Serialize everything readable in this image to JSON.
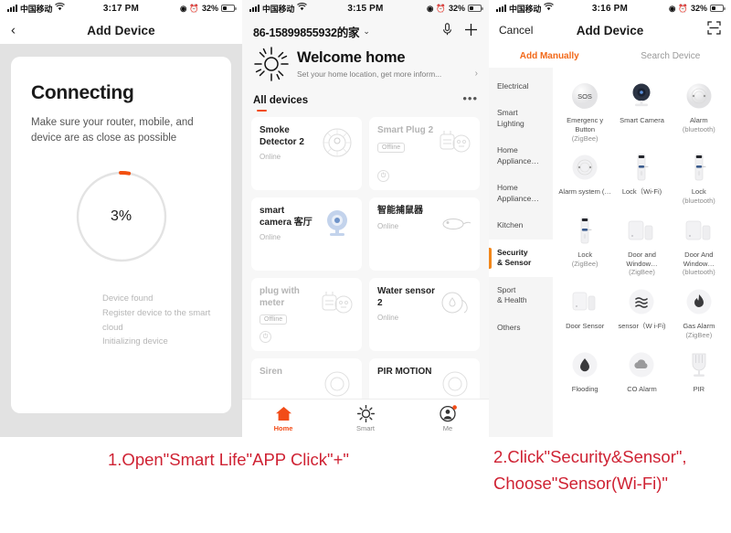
{
  "panel1": {
    "status": {
      "carrier": "中国移动",
      "wifi": "wifi-icon",
      "time": "3:17 PM",
      "battery_pct": "32%",
      "loc_icon": "location-icon",
      "alarm_icon": "alarm-icon"
    },
    "nav": {
      "back": "‹",
      "title": "Add Device"
    },
    "card": {
      "title": "Connecting",
      "subtitle": "Make sure your router, mobile, and device are as close as possible",
      "progress": "3%",
      "progress_value": 3,
      "steps": [
        "Device found",
        "Register device to the smart cloud",
        "Initializing device"
      ]
    }
  },
  "panel2": {
    "status": {
      "carrier": "中国移动",
      "time": "3:15 PM",
      "battery_pct": "32%"
    },
    "header": {
      "home_name": "86-15899855932的家",
      "caret": "⌄",
      "mic_icon": "microphone-icon",
      "add_icon": "plus-icon"
    },
    "welcome": {
      "sun_icon": "sun-icon",
      "title": "Welcome home",
      "subtitle": "Set your home location, get more inform...",
      "chevron": "›"
    },
    "section": {
      "label": "All devices",
      "more": "•••"
    },
    "devices": [
      {
        "name": "Smoke Detector 2",
        "status": "Online",
        "offline": false,
        "icon": "smoke-detector-icon",
        "power": false
      },
      {
        "name": "Smart Plug 2",
        "status": "Offline",
        "offline": true,
        "icon": "smart-plug-icon",
        "power": true
      },
      {
        "name": "smart camera 客厅",
        "status": "Online",
        "offline": false,
        "icon": "camera-icon",
        "power": false
      },
      {
        "name": "智能捕鼠器",
        "status": "Online",
        "offline": false,
        "icon": "mouse-trap-icon",
        "power": false
      },
      {
        "name": "plug with meter",
        "status": "Offline",
        "offline": true,
        "icon": "smart-plug-icon",
        "power": true
      },
      {
        "name": "Water sensor 2",
        "status": "Online",
        "offline": false,
        "icon": "water-sensor-icon",
        "power": false
      },
      {
        "name": "Siren",
        "status": "",
        "offline": false,
        "icon": "siren-icon",
        "power": false
      },
      {
        "name": "PIR MOTION",
        "status": "",
        "offline": false,
        "icon": "pir-motion-icon",
        "power": false
      }
    ],
    "tabs": [
      {
        "label": "Home",
        "icon": "home-icon",
        "active": true
      },
      {
        "label": "Smart",
        "icon": "smart-icon",
        "active": false
      },
      {
        "label": "Me",
        "icon": "profile-icon",
        "active": false
      }
    ]
  },
  "panel3": {
    "status": {
      "carrier": "中国移动",
      "time": "3:16 PM",
      "battery_pct": "32%"
    },
    "nav": {
      "cancel": "Cancel",
      "title": "Add Device",
      "scan_icon": "scan-icon"
    },
    "tabs": [
      {
        "label": "Add Manually",
        "active": true
      },
      {
        "label": "Search Device",
        "active": false
      }
    ],
    "categories": [
      {
        "label": "Electrical",
        "active": false
      },
      {
        "label": "Smart\nLighting",
        "active": false
      },
      {
        "label": "Home\nAppliance…",
        "active": false
      },
      {
        "label": "Home\nAppliance…",
        "active": false
      },
      {
        "label": "Kitchen",
        "active": false
      },
      {
        "label": "Security\n& Sensor",
        "active": true
      },
      {
        "label": "Sport\n& Health",
        "active": false
      },
      {
        "label": "Others",
        "active": false
      }
    ],
    "devices": [
      {
        "label": "Emergenc y Button",
        "sub": "(ZigBee)",
        "icon": "sos-button-icon"
      },
      {
        "label": "Smart Camera",
        "sub": "",
        "icon": "smart-camera-icon"
      },
      {
        "label": "Alarm",
        "sub": "(bluetooth)",
        "icon": "alarm-disc-icon"
      },
      {
        "label": "Alarm system (…",
        "sub": "",
        "icon": "alarm-disc-icon"
      },
      {
        "label": "Lock（Wi-Fi)",
        "sub": "",
        "icon": "door-lock-icon"
      },
      {
        "label": "Lock",
        "sub": "(bluetooth)",
        "icon": "door-lock-icon"
      },
      {
        "label": "Lock",
        "sub": "(ZigBee)",
        "icon": "door-lock-icon"
      },
      {
        "label": "Door and Window…",
        "sub": "(ZigBee)",
        "icon": "door-window-sensor-icon"
      },
      {
        "label": "Door And Window…",
        "sub": "(bluetooth)",
        "icon": "door-window-sensor-icon"
      },
      {
        "label": "Door Sensor",
        "sub": "",
        "icon": "door-window-sensor-icon"
      },
      {
        "label": "sensor（W i-Fi)",
        "sub": "",
        "icon": "motion-wave-icon"
      },
      {
        "label": "Gas Alarm",
        "sub": "(ZigBee)",
        "icon": "gas-flame-icon"
      },
      {
        "label": "Flooding",
        "sub": "",
        "icon": "water-drop-icon"
      },
      {
        "label": "CO Alarm",
        "sub": "",
        "icon": "co-cloud-icon"
      },
      {
        "label": "PIR",
        "sub": "",
        "icon": "pir-sensor-icon"
      }
    ]
  },
  "captions": {
    "one": "1.Open\"Smart Life\"APP Click\"+\"",
    "two_line1": "2.Click\"Security&Sensor\",",
    "two_line2": "Choose\"Sensor(Wi-Fi)\"",
    "color": "#cf2233"
  },
  "colors": {
    "accent_orange": "#f24c18",
    "tab_orange": "#f2691a",
    "caption_red": "#cf2233"
  }
}
